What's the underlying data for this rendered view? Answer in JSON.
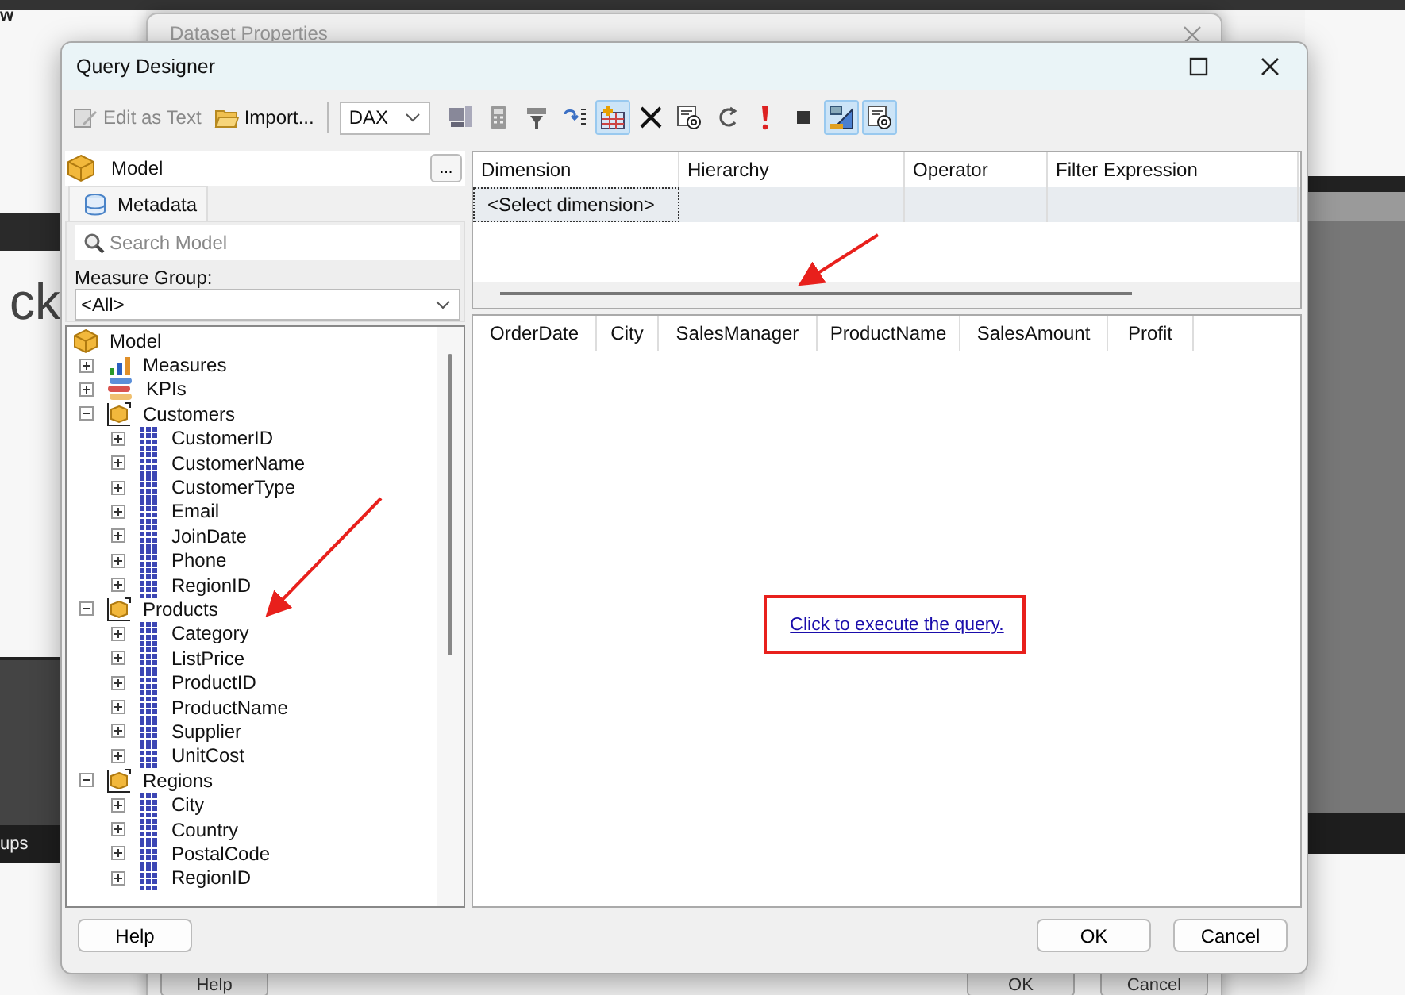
{
  "background": {
    "app_title_fragment": "w",
    "canvas_text": "ck",
    "panel_label": "ups",
    "dialog": {
      "title": "Dataset Properties",
      "buttons": [
        "Help",
        "OK",
        "Cancel"
      ]
    }
  },
  "window": {
    "title": "Query Designer"
  },
  "toolbar": {
    "edit_as_text": "Edit as Text",
    "import": "Import...",
    "language": "DAX",
    "tools": [
      {
        "kind": "server",
        "pressed": false
      },
      {
        "kind": "calculator",
        "pressed": false
      },
      {
        "kind": "filter",
        "pressed": false
      },
      {
        "kind": "list",
        "pressed": false
      },
      {
        "kind": "add-table",
        "pressed": true
      },
      {
        "kind": "delete",
        "pressed": false
      },
      {
        "kind": "at-sheet",
        "pressed": false
      },
      {
        "kind": "rotate",
        "pressed": false
      },
      {
        "kind": "exclamation",
        "pressed": false
      },
      {
        "kind": "stop",
        "pressed": false
      },
      {
        "kind": "design",
        "pressed": true
      },
      {
        "kind": "at-sheet",
        "pressed": true
      }
    ]
  },
  "model": {
    "label": "Model",
    "browse": "...",
    "tab": "Metadata",
    "search_placeholder": "Search Model",
    "measure_group_label": "Measure Group:",
    "measure_group": "<All>"
  },
  "tree": [
    {
      "label": "Model",
      "kind": "model",
      "children": [
        {
          "label": "Measures",
          "kind": "measures",
          "expanded": false
        },
        {
          "label": "KPIs",
          "kind": "kpis",
          "expanded": false
        },
        {
          "label": "Customers",
          "kind": "table",
          "expanded": true,
          "children": [
            {
              "label": "CustomerID",
              "kind": "column",
              "expanded": false
            },
            {
              "label": "CustomerName",
              "kind": "column",
              "expanded": false
            },
            {
              "label": "CustomerType",
              "kind": "column",
              "expanded": false
            },
            {
              "label": "Email",
              "kind": "column",
              "expanded": false
            },
            {
              "label": "JoinDate",
              "kind": "column",
              "expanded": false
            },
            {
              "label": "Phone",
              "kind": "column",
              "expanded": false
            },
            {
              "label": "RegionID",
              "kind": "column",
              "expanded": false
            }
          ]
        },
        {
          "label": "Products",
          "kind": "table",
          "expanded": true,
          "children": [
            {
              "label": "Category",
              "kind": "column",
              "expanded": false
            },
            {
              "label": "ListPrice",
              "kind": "column",
              "expanded": false
            },
            {
              "label": "ProductID",
              "kind": "column",
              "expanded": false
            },
            {
              "label": "ProductName",
              "kind": "column",
              "expanded": false
            },
            {
              "label": "Supplier",
              "kind": "column",
              "expanded": false
            },
            {
              "label": "UnitCost",
              "kind": "column",
              "expanded": false
            }
          ]
        },
        {
          "label": "Regions",
          "kind": "table",
          "expanded": true,
          "children": [
            {
              "label": "City",
              "kind": "column",
              "expanded": false
            },
            {
              "label": "Country",
              "kind": "column",
              "expanded": false
            },
            {
              "label": "PostalCode",
              "kind": "column",
              "expanded": false
            },
            {
              "label": "RegionID",
              "kind": "column",
              "expanded": false
            }
          ]
        }
      ]
    }
  ],
  "filter_grid": {
    "columns": [
      "Dimension",
      "Hierarchy",
      "Operator",
      "Filter Expression"
    ],
    "select_row": "<Select dimension>"
  },
  "results": {
    "columns": [
      "OrderDate",
      "City",
      "SalesManager",
      "ProductName",
      "SalesAmount",
      "Profit"
    ],
    "link": "Click to execute the query."
  },
  "buttons": {
    "help": "Help",
    "ok": "OK",
    "cancel": "Cancel"
  }
}
